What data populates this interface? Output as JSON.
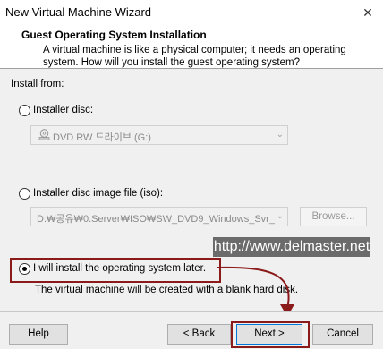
{
  "window": {
    "title": "New Virtual Machine Wizard",
    "close_glyph": "✕"
  },
  "header": {
    "title": "Guest Operating System Installation",
    "description_line1": "A virtual machine is like a physical computer; it needs an operating",
    "description_line2": "system. How will you install the guest operating system?"
  },
  "install_from": {
    "label": "Install from:",
    "options": [
      {
        "label": "Installer disc:",
        "selected": false
      },
      {
        "label": "Installer disc image file (iso):",
        "selected": false
      },
      {
        "label": "I will install the operating system later.",
        "selected": true
      }
    ],
    "disc_dropdown": {
      "value": "DVD RW 드라이브 (G:)",
      "icon": "disc-drive-icon"
    },
    "iso_dropdown": {
      "value": "D:₩공유₩0.Server₩ISO₩SW_DVD9_Windows_Svr_"
    },
    "browse_label": "Browse...",
    "later_note": "The virtual machine will be created with a blank hard disk."
  },
  "watermark": {
    "text": "http://www.delmaster.net"
  },
  "footer": {
    "help_label": "Help",
    "back_label": "< Back",
    "next_label": "Next >",
    "cancel_label": "Cancel"
  },
  "colors": {
    "highlight": "#8b1a1a",
    "watermark_bg": "#6b6b6b"
  }
}
